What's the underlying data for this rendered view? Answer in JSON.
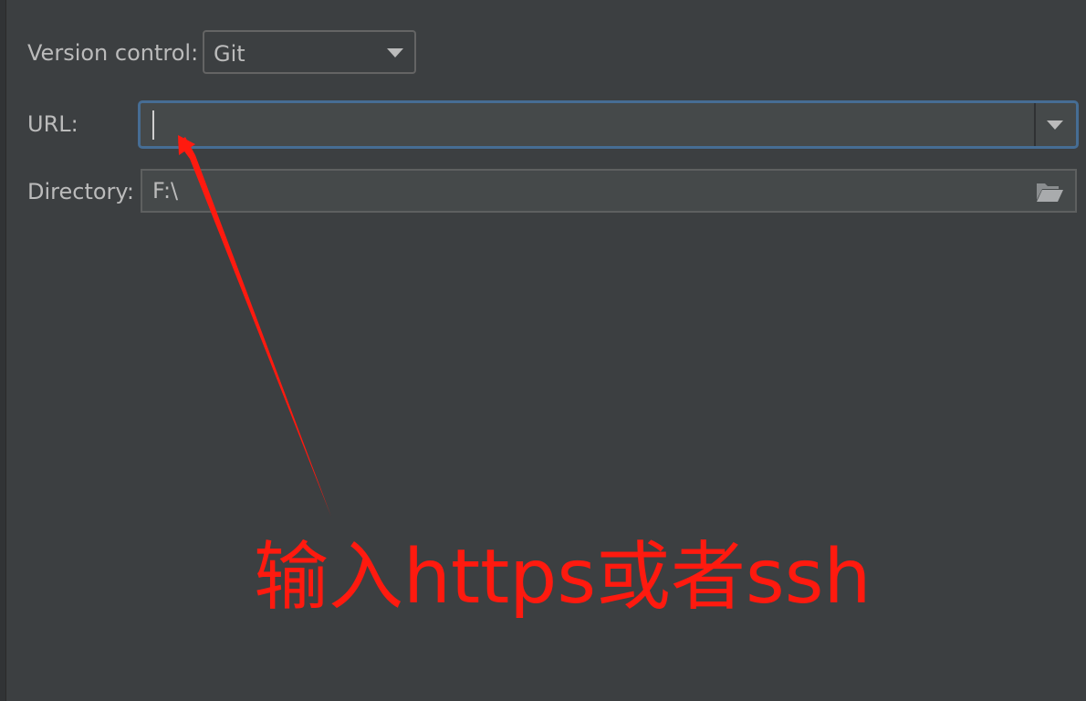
{
  "form": {
    "version_control": {
      "label": "Version control:",
      "value": "Git"
    },
    "url": {
      "label": "URL:",
      "value": ""
    },
    "directory": {
      "label": "Directory:",
      "value": "F:\\"
    }
  },
  "annotation": {
    "text": "输入https或者ssh",
    "color": "#ff1a0f"
  },
  "colors": {
    "background": "#3c3f41",
    "focus_border": "#466d94",
    "text": "#bbbbbb"
  },
  "icons": {
    "combo_arrow": "chevron-down-icon",
    "folder": "folder-open-icon"
  }
}
